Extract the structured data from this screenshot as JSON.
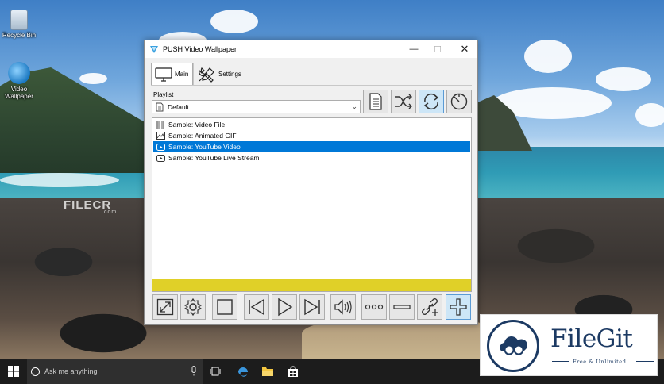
{
  "desktop": {
    "icons": [
      {
        "label": "Recycle Bin"
      },
      {
        "label": "Video Wallpaper"
      }
    ],
    "watermark": {
      "text": "FILECR",
      "sub": ".com"
    }
  },
  "window": {
    "title": "PUSH Video Wallpaper",
    "controls": {
      "minimize": "—",
      "maximize": "☐",
      "close": "✕"
    },
    "tabs": [
      {
        "label": "Main",
        "icon": "monitor-icon",
        "active": true
      },
      {
        "label": "Settings",
        "icon": "tools-icon",
        "active": false
      }
    ],
    "playlist": {
      "label": "Playlist",
      "selected": "Default",
      "buttons": [
        "playlist-edit-icon",
        "shuffle-icon",
        "loop-icon",
        "timer-icon"
      ]
    },
    "items": [
      {
        "label": "Sample: Video File",
        "icon": "film-icon",
        "selected": false
      },
      {
        "label": "Sample: Animated GIF",
        "icon": "image-icon",
        "selected": false
      },
      {
        "label": "Sample: YouTube Video",
        "icon": "youtube-icon",
        "selected": true
      },
      {
        "label": "Sample: YouTube Live Stream",
        "icon": "youtube-icon",
        "selected": false
      }
    ],
    "progress_color": "#e0d028",
    "accent_color": "#0078d7",
    "controls_bar": [
      "fullscreen-icon",
      "settings-icon",
      "stop-icon",
      "previous-icon",
      "play-icon",
      "next-icon",
      "volume-icon",
      "more-icon",
      "remove-icon",
      "add-url-icon",
      "add-icon"
    ]
  },
  "taskbar": {
    "search_placeholder": "Ask me anything",
    "apps": [
      "task-view-icon",
      "edge-icon",
      "file-explorer-icon",
      "store-icon"
    ]
  },
  "badge": {
    "name": "FileGit",
    "tagline": "Free & Unlimited"
  }
}
